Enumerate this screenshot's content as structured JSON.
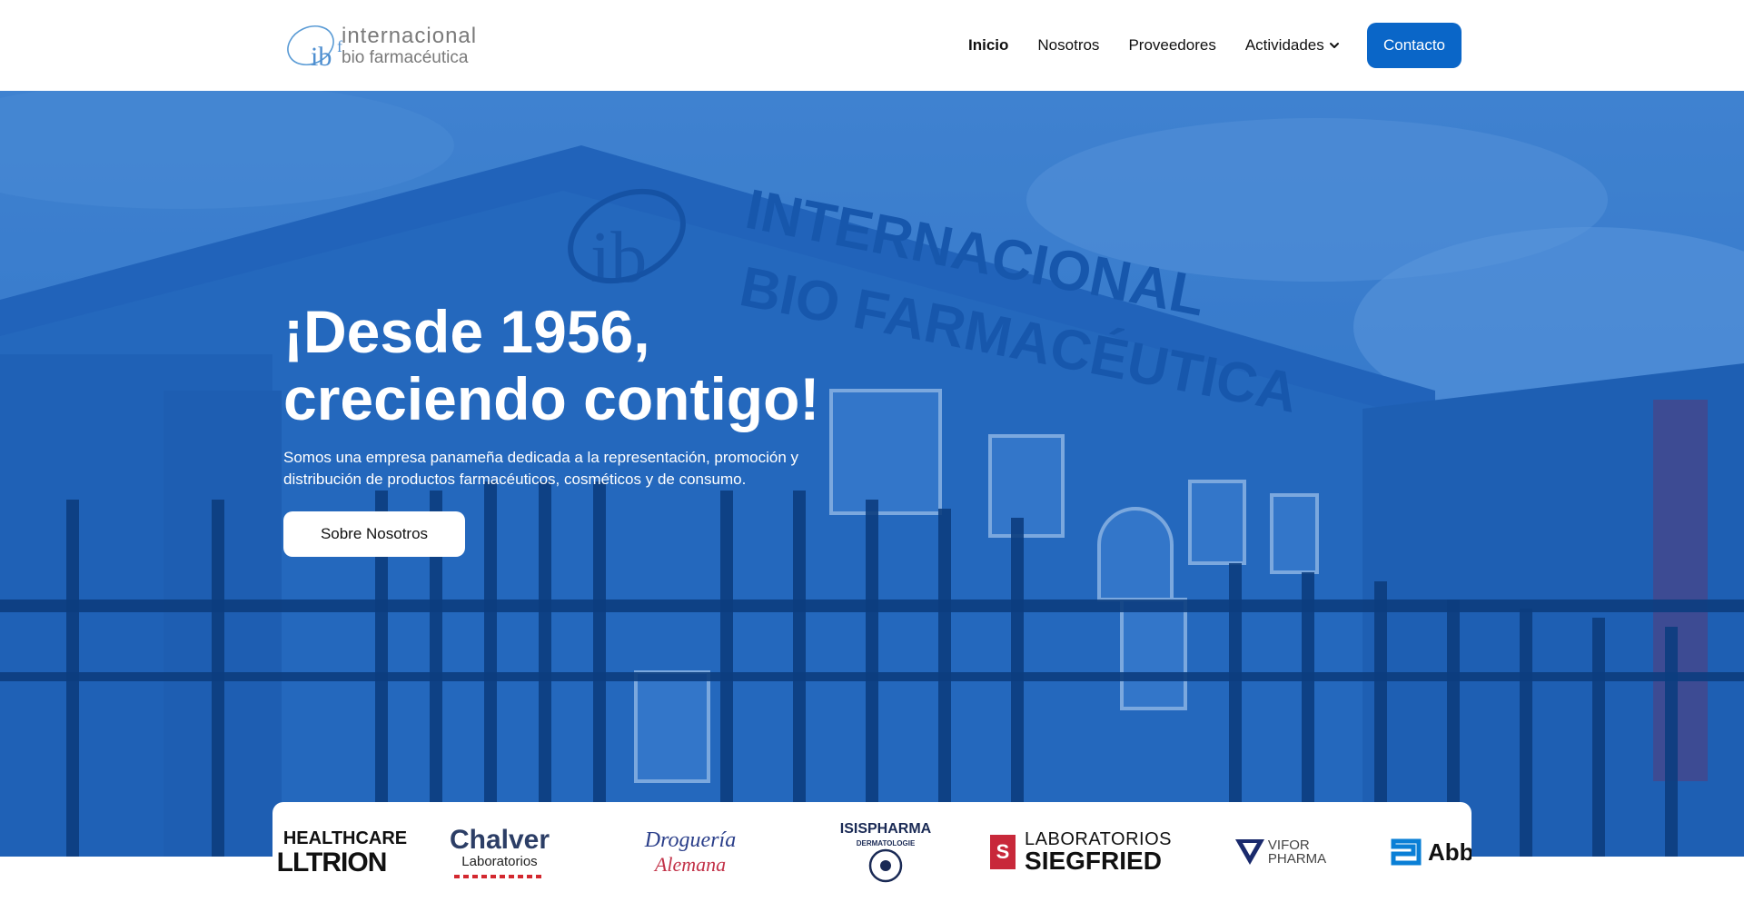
{
  "header": {
    "logo": {
      "mark": "ib",
      "line1": "internacional",
      "line2": "bio farmacéutica"
    },
    "nav": [
      {
        "label": "Inicio",
        "active": true
      },
      {
        "label": "Nosotros",
        "active": false
      },
      {
        "label": "Proveedores",
        "active": false
      },
      {
        "label": "Actividades",
        "active": false,
        "icon": "chevron-down-icon"
      }
    ],
    "contact_label": "Contacto"
  },
  "hero": {
    "building_sign_line1": "INTERNACIONAL",
    "building_sign_line2": "BIO FARMACÉUTICA",
    "building_sign_logo": "ib",
    "title_line1": "¡Desde 1956,",
    "title_line2": "creciendo contigo!",
    "subtitle": "Somos una empresa panameña dedicada a la representación, promoción y distribución de productos farmacéuticos, cosméticos y de consumo.",
    "button_label": "Sobre Nosotros"
  },
  "brands": [
    {
      "name": "celltrion",
      "top": "HEALTHCARE",
      "main": "LLTRION"
    },
    {
      "name": "chalver",
      "main": "Chalver",
      "sub": "Laboratorios"
    },
    {
      "name": "droguería-alemana",
      "main": "Droguería",
      "sub": "Alemana"
    },
    {
      "name": "isispharma",
      "main": "ISISPHARMA",
      "sub": "DERMATOLOGIE"
    },
    {
      "name": "siegfried",
      "top": "LABORATORIOS",
      "main": "SIEGFRIED"
    },
    {
      "name": "vifor",
      "main": "VIFOR",
      "sub": "PHARMA"
    },
    {
      "name": "abbott",
      "main": "Abbo"
    }
  ],
  "colors": {
    "primary": "#0a66c8",
    "hero_tint": "#1f63b8",
    "text_dark": "#111111",
    "logo_gray": "#7a7a7a"
  }
}
